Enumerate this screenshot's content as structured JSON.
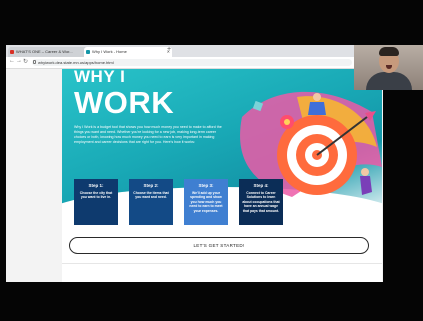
{
  "browser": {
    "tabs": [
      {
        "label": "WHAT'S ONE – Career & Wor...",
        "favicon_color": "#d93025"
      },
      {
        "label": "Why I Work - Home",
        "favicon_color": "#1496a8"
      }
    ],
    "new_tab": "+",
    "url": "whyiwork.dea.state.mn.us/apps/home.html"
  },
  "hero": {
    "title_line1": "WHY I",
    "title_line2": "WORK",
    "intro": "Why I Work is a budget tool that shows you how much money you need to make to afford the things you want and need. Whether you're looking for a new job, making long-term career choices or both, knowing how much money you need to earn is very important in making employment and career decisions that are right for you. Here's how it works:"
  },
  "steps": [
    {
      "title": "Step 1:",
      "desc": "Choose the city that you want to live in."
    },
    {
      "title": "Step 2:",
      "desc": "Choose the items that you want and need."
    },
    {
      "title": "Step 3:",
      "desc": "We'll add up your spending and show you how much you need to earn to meet your expenses."
    },
    {
      "title": "Step 4:",
      "desc": "Connect to Career Solutions to learn about occupations that have an annual wage that pays that amount."
    }
  ],
  "cta": {
    "label": "LET'S GET STARTED!"
  },
  "colors": {
    "hero_teal": "#19a9b6",
    "step_dark": "#0e3a6e",
    "step_light": "#3f7fd1"
  }
}
